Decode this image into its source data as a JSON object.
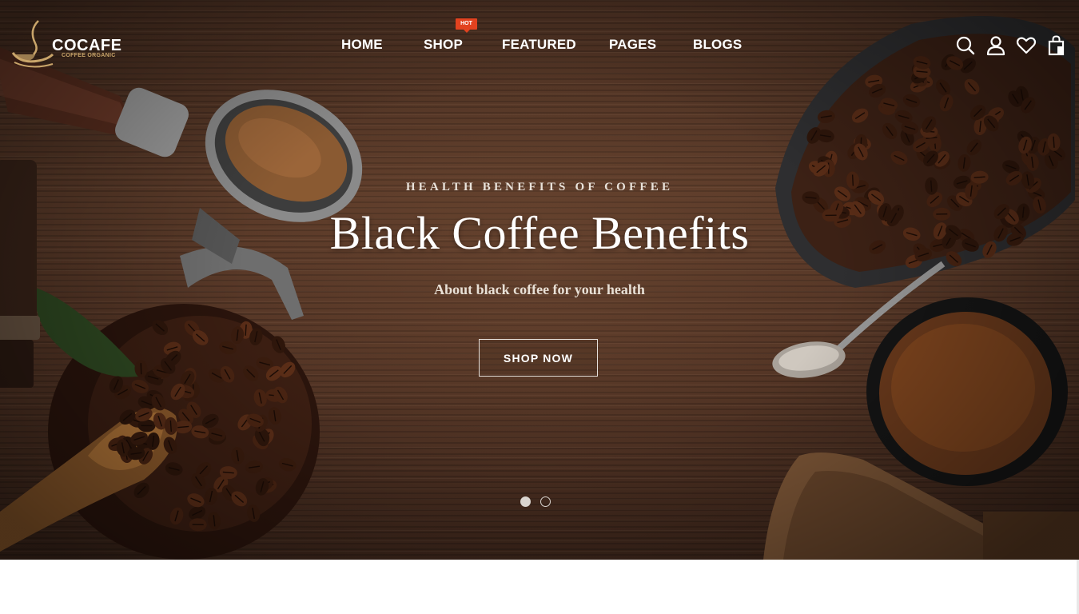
{
  "brand": {
    "name": "COCAFE",
    "tagline": "COFFEE ORGANIC"
  },
  "nav": {
    "items": [
      {
        "label": "HOME"
      },
      {
        "label": "SHOP",
        "badge": "HOT"
      },
      {
        "label": "FEATURED"
      },
      {
        "label": "PAGES"
      },
      {
        "label": "BLOGS"
      }
    ]
  },
  "header_icons": [
    "search-icon",
    "user-icon",
    "heart-icon",
    "shopping-bag-icon"
  ],
  "hero": {
    "eyebrow": "HEALTH BENEFITS OF COFFEE",
    "headline": "Black Coffee Benefits",
    "subline": "About black coffee for your health",
    "cta_label": "SHOP NOW",
    "slides": {
      "count": 2,
      "active": 1
    }
  },
  "colors": {
    "badge": "#e2421f",
    "logo_accent": "#c9a56a",
    "text": "#ffffff",
    "wood": "#5d3c2a"
  }
}
